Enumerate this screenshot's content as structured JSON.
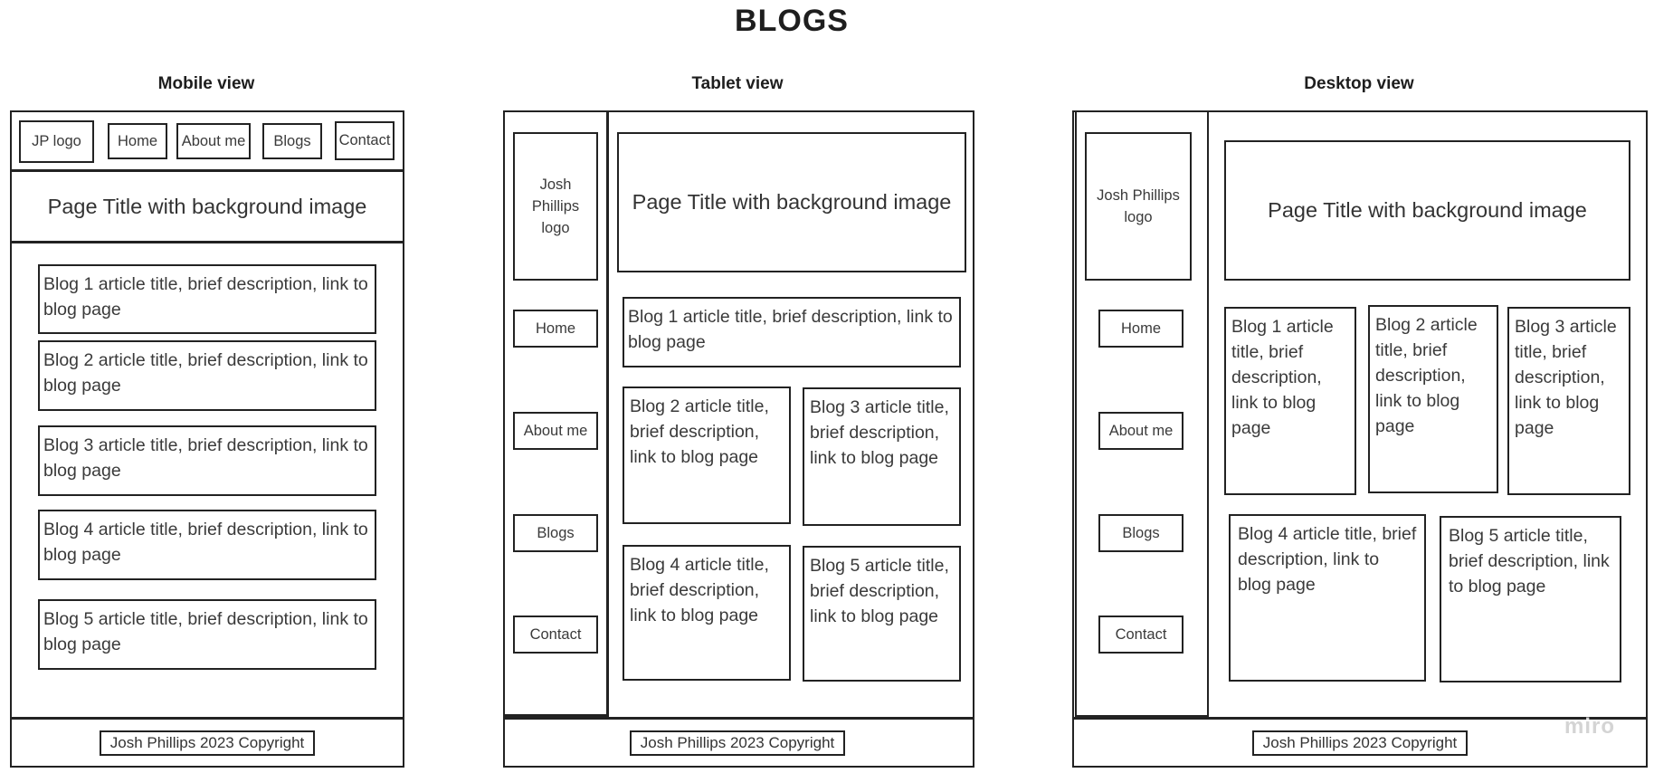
{
  "title": "BLOGS",
  "views": {
    "mobile": {
      "heading": "Mobile view",
      "nav": [
        "JP logo",
        "Home",
        "About me",
        "Blogs",
        "Contact"
      ],
      "page_title": "Page Title with background image",
      "blogs": [
        "Blog 1 article title, brief description, link to blog page",
        "Blog 2 article title, brief description, link to blog page",
        "Blog 3 article title, brief description, link to blog page",
        "Blog 4 article title, brief description, link to blog page",
        "Blog 5 article title, brief description, link to blog page"
      ],
      "footer": "Josh Phillips 2023 Copyright"
    },
    "tablet": {
      "heading": "Tablet view",
      "logo": "Josh Phillips logo",
      "nav": [
        "Home",
        "About me",
        "Blogs",
        "Contact"
      ],
      "page_title": "Page Title with background image",
      "blogs": [
        "Blog 1 article title, brief description, link to blog page",
        "Blog 2 article title, brief description, link to blog page",
        "Blog 3 article title, brief description, link to blog page",
        "Blog 4 article title, brief description, link to blog page",
        "Blog 5 article title, brief description, link to blog page"
      ],
      "footer": "Josh Phillips 2023 Copyright"
    },
    "desktop": {
      "heading": "Desktop view",
      "logo": "Josh Phillips logo",
      "nav": [
        "Home",
        "About me",
        "Blogs",
        "Contact"
      ],
      "page_title": "Page Title with background image",
      "blogs": [
        "Blog 1 article title, brief description, link to blog page",
        "Blog 2 article title, brief description, link to blog page",
        "Blog 3 article title, brief description, link to blog page",
        "Blog 4 article title, brief description, link to blog page",
        "Blog 5 article title, brief description, link to blog page"
      ],
      "footer": "Josh Phillips 2023 Copyright"
    }
  },
  "watermark": "miro"
}
